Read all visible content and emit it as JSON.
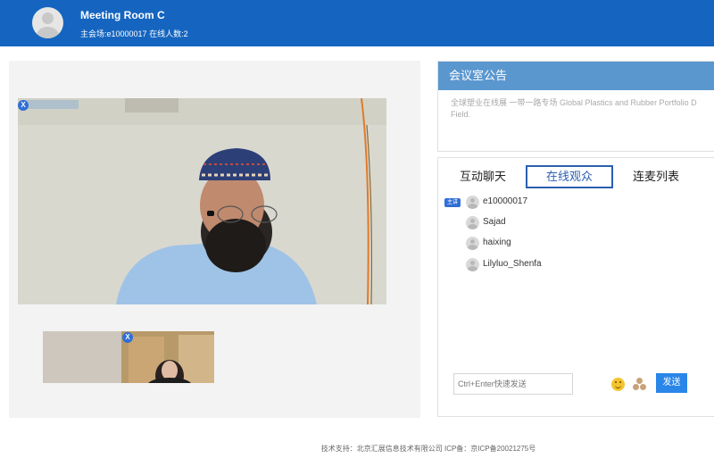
{
  "header": {
    "room_title": "Meeting Room C",
    "host_label": "主会场:",
    "host_id": "e10000017",
    "online_label": "在线人数:",
    "online_count": "2"
  },
  "video": {
    "main_close": "X",
    "small_close": "X"
  },
  "notice": {
    "title": "会议室公告",
    "text": "全球塑业在线展 一带一路专场 Global Plastics and Rubber Portfolio D Field."
  },
  "chat": {
    "tabs": [
      "互动聊天",
      "在线观众",
      "连麦列表"
    ],
    "active_tab": "在线观众",
    "host_tag": "主讲",
    "users": [
      "e10000017",
      "Sajad",
      "haixing",
      "Lilyluo_Shenfa"
    ],
    "input_placeholder": "Ctrl+Enter快速发送",
    "send_label": "发送"
  },
  "footer": {
    "text": "技术支持：北京汇展信息技术有限公司 ICP备：京ICP备20021275号"
  },
  "colors": {
    "header_bg": "#1565c0",
    "notice_head_bg": "#5b97cf",
    "accent": "#2b5fb0",
    "send_btn": "#2a86e8"
  },
  "icons": {
    "avatar": "user-avatar-icon",
    "emoji": "emoji-icon",
    "gift": "gift-icon"
  }
}
